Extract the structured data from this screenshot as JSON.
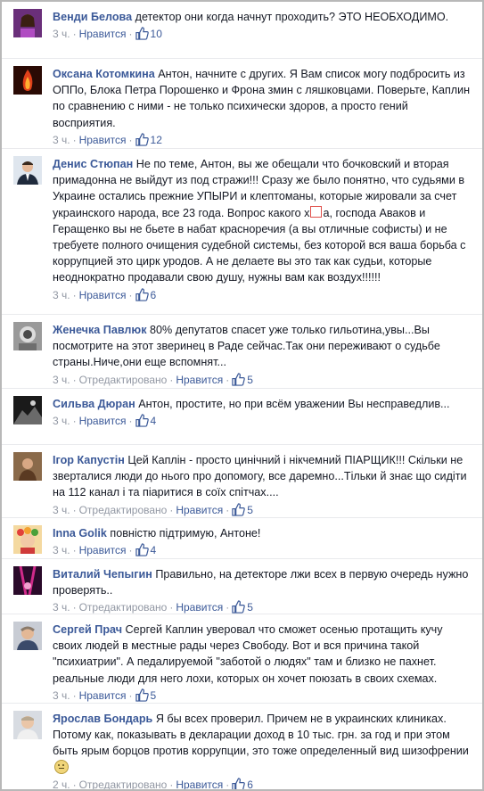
{
  "comments": [
    {
      "avatar": "woman-avatar",
      "name": "Венди Белова",
      "text": "детектор они когда начнут проходить? ЭТО НЕОБХОДИМО.",
      "time": "3 ч.",
      "action": "Нравится",
      "likes": "10"
    },
    {
      "avatar": "fire-avatar",
      "name": "Оксана Котомкина",
      "text": "Антон, начните с других. Я Вам список могу подбросить из ОППо, Блока Петра Порошенко и Фрона змин с ляшковцами. Поверьте, Каплин по сравнению с ними - не только психически здоров, а просто гений восприятия.",
      "time": "3 ч.",
      "action": "Нравится",
      "likes": "12"
    },
    {
      "avatar": "man-suit-avatar",
      "name": "Денис Стюпан",
      "text_before": "Не по теме, Антон, вы же обещали что бочковский и вторая примадонна не выйдут из под стражи!!! Сразу же было понятно, что судьями в Украине остались прежние УПЫРИ и клептоманы, которые жировали за счет украинского народа, все 23 года. Вопрос какого х",
      "text_after": "а, господа Аваков и Геращенко вы не бьете в набат красноречия (а вы отличные софисты) и не требуете полного очищения судебной системы, без которой вся ваша борьба с коррупцией это цирк уродов. А не делаете вы это так как судьи, которые неоднократно продавали свою душу, нужны вам как воздух!!!!!!",
      "time": "3 ч.",
      "action": "Нравится",
      "likes": "6"
    },
    {
      "avatar": "vintage-photo-avatar",
      "name": "Женечка Павлюк",
      "text": "80% депутатов спасет уже только гильотина,увы...Вы посмотрите на этот зверинец в Раде сейчас.Так они переживают о судьбе страны.Ниче,они еще вспомнят...",
      "time": "3 ч.",
      "edited": "Отредактировано",
      "action": "Нравится",
      "likes": "5"
    },
    {
      "avatar": "dark-photo-avatar",
      "name": "Сильва Дюран",
      "text": "Антон, простите, но при всём уважении Вы несправедлив...",
      "time": "3 ч.",
      "action": "Нравится",
      "likes": "4"
    },
    {
      "avatar": "man-brown-avatar",
      "name": "Ігор Капустін",
      "text": "Цей Каплін - просто цинічний і нікчемний ПІАРЩИК!!! Скільки не зверталися люди до нього про допомогу, все даремно...Тільки й знає що сидіти на 112 канал і та піаритися в соїх спітчах....",
      "time": "3 ч.",
      "edited": "Отредактировано",
      "action": "Нравится",
      "likes": "5"
    },
    {
      "avatar": "girl-wreath-avatar",
      "name": "Inna Golik",
      "text": "повністю підтримую, Антоне!",
      "time": "3 ч.",
      "action": "Нравится",
      "likes": "4"
    },
    {
      "avatar": "concert-avatar",
      "name": "Виталий Чепыгин",
      "text": "Правильно, на детекторе лжи всех в первую очередь нужно проверять..",
      "time": "3 ч.",
      "edited": "Отредактировано",
      "action": "Нравится",
      "likes": "5"
    },
    {
      "avatar": "man-face-avatar",
      "name": "Сергей Прач",
      "text": "Сергей Каплин уверовал что сможет осенью протащить кучу своих людей в местные рады через Свободу. Вот и вся причина такой \"психиатрии\". А педалируемой \"заботой о людях\" там и близко не пахнет. реальные люди для него лохи, которых он хочет поюзать в своих схемах.",
      "time": "3 ч.",
      "action": "Нравится",
      "likes": "5"
    },
    {
      "avatar": "man-light-avatar",
      "name": "Ярослав Бондарь",
      "text": "Я бы всех проверил. Причем не в украинских клиниках. Потому как, показывать в декларации доход в 10 тыс. грн. за год и при этом быть ярым борцов против коррупции, это тоже определенный вид шизофрении",
      "time": "2 ч.",
      "edited": "Отредактировано",
      "action": "Нравится",
      "likes": "6"
    }
  ],
  "colors": {
    "name": "#3b5998",
    "text": "#141823",
    "meta": "#9197a3",
    "link": "#3b5998",
    "border": "#b8b8b8"
  }
}
